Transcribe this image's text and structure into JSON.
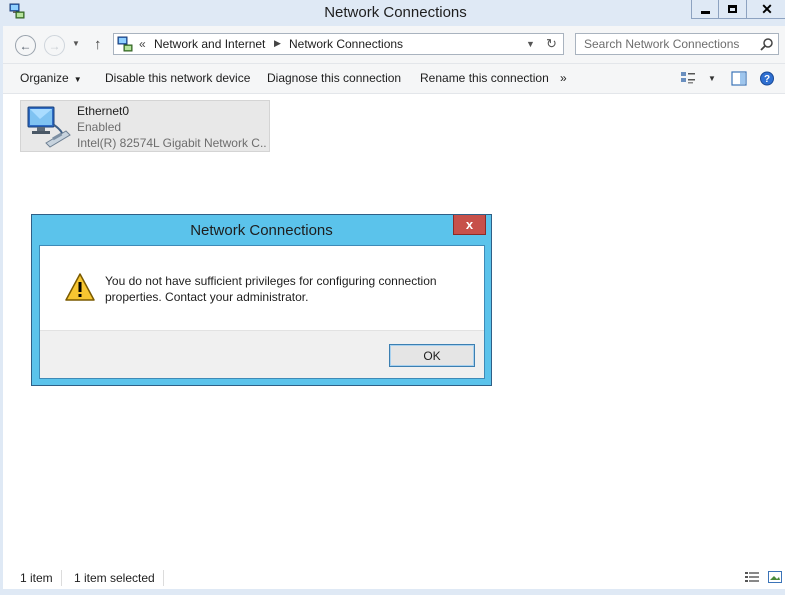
{
  "window": {
    "title": "Network Connections",
    "icon": "network-connections-icon"
  },
  "address_bar": {
    "overflow_chevron": "«",
    "breadcrumb": [
      "Network and Internet",
      "Network Connections"
    ]
  },
  "search": {
    "placeholder": "Search Network Connections"
  },
  "command_bar": {
    "organize": "Organize",
    "disable": "Disable this network device",
    "diagnose": "Diagnose this connection",
    "rename": "Rename this connection",
    "more": "»"
  },
  "items": [
    {
      "name": "Ethernet0",
      "status": "Enabled",
      "device": "Intel(R) 82574L Gigabit Network C..."
    }
  ],
  "status_bar": {
    "count": "1 item",
    "selected": "1 item selected"
  },
  "dialog": {
    "title": "Network Connections",
    "message": "You do not have sufficient privileges for configuring connection properties. Contact your administrator.",
    "ok_label": "OK",
    "close_glyph": "x",
    "icon": "warning-icon"
  },
  "colors": {
    "dialog_frame": "#5bc3eb",
    "dialog_close": "#c7504a",
    "window_frame": "#dfe9f5"
  }
}
